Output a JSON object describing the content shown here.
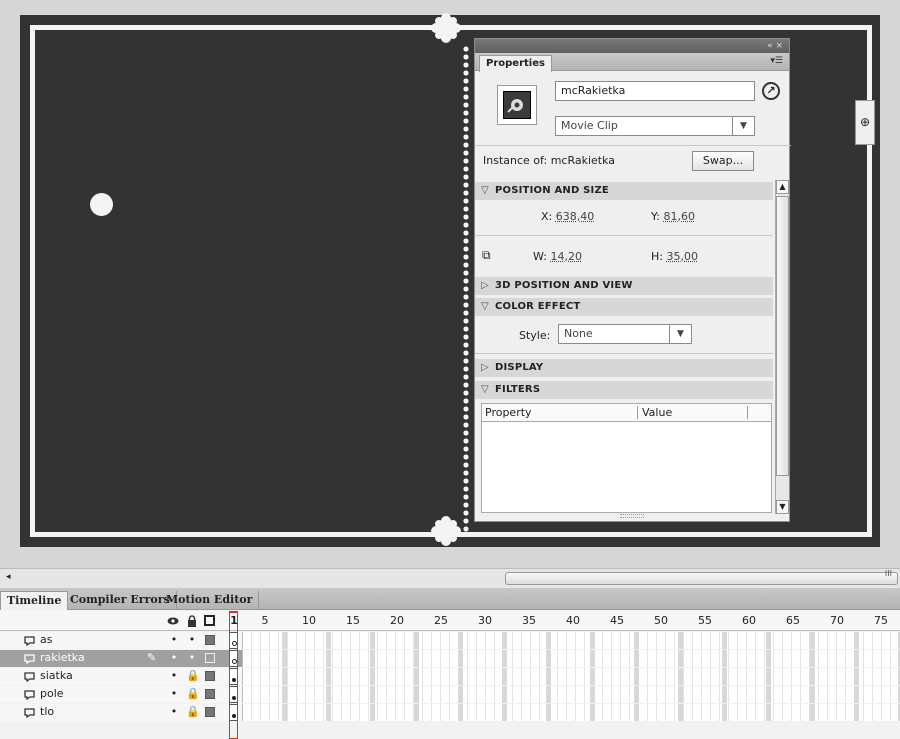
{
  "properties_panel": {
    "tab_label": "Properties",
    "titlebar_controls": "«  ×",
    "menu_glyph": "▾☰",
    "instance_name": "mcRakietka",
    "symbol_type": "Movie Clip",
    "instance_of_label": "Instance of:",
    "instance_of_value": "mcRakietka",
    "swap_label": "Swap...",
    "sections": {
      "position_size": "POSITION AND SIZE",
      "position_3d": "3D POSITION AND VIEW",
      "color_effect": "COLOR EFFECT",
      "display": "DISPLAY",
      "filters": "FILTERS"
    },
    "position": {
      "x_label": "X:",
      "x_value": "638,40",
      "y_label": "Y:",
      "y_value": "81,60",
      "w_label": "W:",
      "w_value": "14,20",
      "h_label": "H:",
      "h_value": "35,00"
    },
    "color_effect": {
      "style_label": "Style:",
      "style_value": "None"
    },
    "filters_table": {
      "col_property": "Property",
      "col_value": "Value"
    }
  },
  "right_collapse_glyph": "⊕",
  "hscroll_grip": "III",
  "timeline": {
    "tabs": [
      "Timeline",
      "Compiler Errors",
      "Motion Editor"
    ],
    "frame_numbers": [
      "1",
      "5",
      "10",
      "15",
      "20",
      "25",
      "30",
      "35",
      "40",
      "45",
      "50",
      "55",
      "60",
      "65",
      "70",
      "75"
    ],
    "header_icons": {
      "eye": "👁",
      "lock": "🔒",
      "outline": "□"
    },
    "layers": [
      {
        "name": "as",
        "eye": "•",
        "lock": "•",
        "selected": false,
        "keyframe": "empty"
      },
      {
        "name": "rakietka",
        "eye": "•",
        "lock": "•",
        "selected": true,
        "keyframe": "empty"
      },
      {
        "name": "siatka",
        "eye": "•",
        "lock": "🔒",
        "selected": false,
        "keyframe": "filled"
      },
      {
        "name": "pole",
        "eye": "•",
        "lock": "🔒",
        "selected": false,
        "keyframe": "filled"
      },
      {
        "name": "tlo",
        "eye": "•",
        "lock": "🔒",
        "selected": false,
        "keyframe": "filled"
      }
    ]
  }
}
